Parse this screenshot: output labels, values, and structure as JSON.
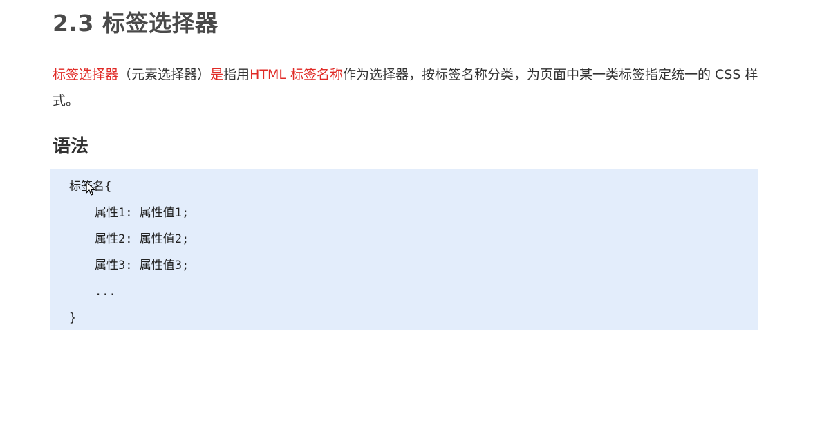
{
  "title": "2.3 标签选择器",
  "intro": {
    "term": "标签选择器",
    "aside": "（元素选择器）",
    "is": "是",
    "verb": "指用",
    "key_phrase": "HTML 标签名称",
    "rest": "作为选择器，按标签名称分类，为页面中某一类标签指定统一的 CSS 样式。"
  },
  "syntax_heading": "语法",
  "code": {
    "open": "标签名{",
    "lines": [
      "属性1: 属性值1;",
      "属性2: 属性值2;",
      "属性3: 属性值3;",
      "..."
    ],
    "close": "}"
  },
  "colors": {
    "highlight": "#e02b27",
    "code_background": "#e3edfb",
    "title": "#4a4a4a"
  },
  "icons": {
    "cursor": "mouse-pointer-icon"
  }
}
